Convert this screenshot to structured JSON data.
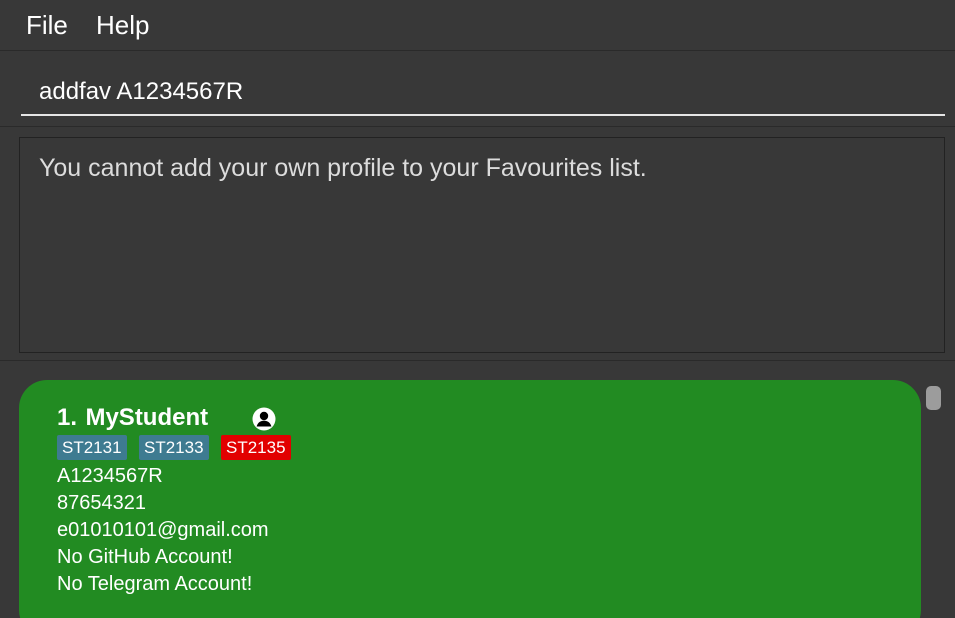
{
  "menu": {
    "file_label": "File",
    "help_label": "Help"
  },
  "command": {
    "value": "addfav A1234567R"
  },
  "result": {
    "message": "You cannot add your own profile to your Favourites list."
  },
  "list": {
    "cards": [
      {
        "index": "1.",
        "name": "MyStudent",
        "icon": "profile-icon",
        "tags": [
          {
            "label": "ST2131",
            "color": "#3e7b91"
          },
          {
            "label": "ST2133",
            "color": "#3e7b91"
          },
          {
            "label": "ST2135",
            "color": "#e20000"
          }
        ],
        "student_id": "A1234567R",
        "phone": "87654321",
        "email": "e01010101@gmail.com",
        "github": "No GitHub Account!",
        "telegram": "No Telegram Account!",
        "card_color": "#228b22"
      }
    ]
  }
}
